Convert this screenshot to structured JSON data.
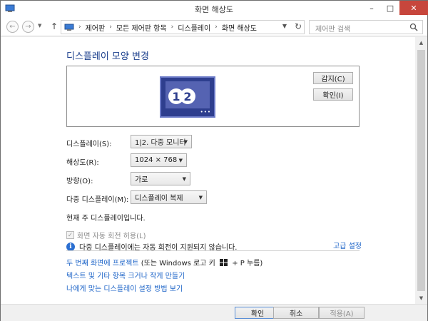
{
  "window": {
    "title": "화면 해상도"
  },
  "address": {
    "crumbs": [
      "제어판",
      "모든 제어판 항목",
      "디스플레이",
      "화면 해상도"
    ],
    "search_placeholder": "제어판 검색"
  },
  "main": {
    "title": "디스플레이 모양 변경",
    "detect_label": "감지(C)",
    "identify_label": "확인(I)",
    "monitor_numbers": [
      "1",
      "2"
    ],
    "rows": {
      "display": {
        "label": "디스플레이(S):",
        "value": "1|2. 다중 모니터"
      },
      "resolution": {
        "label": "해상도(R):",
        "value": "1024 × 768"
      },
      "orientation": {
        "label": "방향(O):",
        "value": "가로"
      },
      "multi": {
        "label": "다중 디스플레이(M):",
        "value": "디스플레이 복제"
      }
    },
    "primary_text": "현재 주 디스플레이입니다.",
    "auto_rotate_label": "화면 자동 회전 허용(L)",
    "info_text": "다중 디스플레이에는 자동 회전이 지원되지 않습니다.",
    "advanced_link": "고급 설정",
    "links": {
      "project_link": "두 번째 화면에 프로젝트",
      "project_suffix_a": "(또는 Windows 로고 키",
      "project_suffix_b": "+ P 누름)",
      "text_size_link": "텍스트 및 기타 항목 크거나 작게 만들기",
      "help_link": "나에게 맞는 디스플레이 설정 방법 보기"
    }
  },
  "footer": {
    "ok_label": "확인",
    "cancel_label": "취소",
    "apply_label": "적용(A)"
  },
  "colors": {
    "title_blue": "#1a3e8c",
    "link_blue": "#1a62c7",
    "close_red": "#c7463c",
    "monitor_blue": "#2e3e8e"
  },
  "icons": [
    "control-panel-icon",
    "back-icon",
    "forward-icon",
    "up-arrow-icon",
    "refresh-icon",
    "search-icon",
    "info-icon",
    "windows-logo-icon",
    "checkmark-icon"
  ]
}
